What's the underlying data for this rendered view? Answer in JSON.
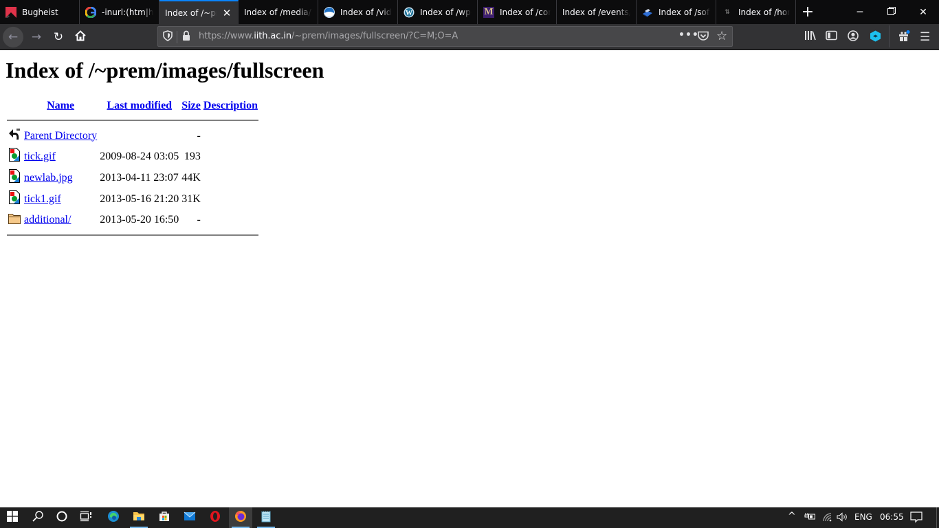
{
  "browser": {
    "tabs": [
      {
        "label": "Bugheist",
        "icon": "bugheist-icon",
        "active": false
      },
      {
        "label": "-inurl:(htm|html",
        "icon": "google-icon",
        "active": false
      },
      {
        "label": "Index of /~prem",
        "icon": "",
        "active": true
      },
      {
        "label": "Index of /media/T",
        "icon": "",
        "active": false
      },
      {
        "label": "Index of /video",
        "icon": "noaa-icon",
        "active": false
      },
      {
        "label": "Index of /wp-c",
        "icon": "wordpress-icon",
        "active": false
      },
      {
        "label": "Index of /com",
        "icon": "m-logo-icon",
        "active": false
      },
      {
        "label": "Index of /events/W",
        "icon": "",
        "active": false
      },
      {
        "label": "Index of /soft",
        "icon": "software-icon",
        "active": false
      },
      {
        "label": "Index of /hom",
        "icon": "generic-page-icon",
        "active": false
      }
    ],
    "new_tab_label": "+",
    "url": {
      "scheme": "https://www.",
      "host": "iith.ac.in",
      "path": "/~prem/images/fullscreen/?C=M;O=A"
    }
  },
  "page": {
    "title": "Index of /~prem/images/fullscreen",
    "columns": {
      "name": "Name",
      "last_modified": "Last modified",
      "size": "Size",
      "description": "Description"
    },
    "rows": [
      {
        "icon": "parent-directory-icon",
        "name": "Parent Directory",
        "modified": "",
        "size": "-",
        "description": ""
      },
      {
        "icon": "image-file-icon",
        "name": "tick.gif",
        "modified": "2009-08-24 03:05",
        "size": "193",
        "description": ""
      },
      {
        "icon": "image-file-icon",
        "name": "newlab.jpg",
        "modified": "2013-04-11 23:07",
        "size": "44K",
        "description": ""
      },
      {
        "icon": "image-file-icon",
        "name": "tick1.gif",
        "modified": "2013-05-16 21:20",
        "size": "31K",
        "description": ""
      },
      {
        "icon": "folder-icon",
        "name": "additional/",
        "modified": "2013-05-20 16:50",
        "size": "-",
        "description": ""
      }
    ]
  },
  "taskbar": {
    "language": "ENG",
    "time": "06:55"
  },
  "colors": {
    "link": "#0000ee",
    "tab_accent": "#0a84ff",
    "toolbar_bg": "#323234",
    "tabbar_bg": "#0c0c0d"
  }
}
